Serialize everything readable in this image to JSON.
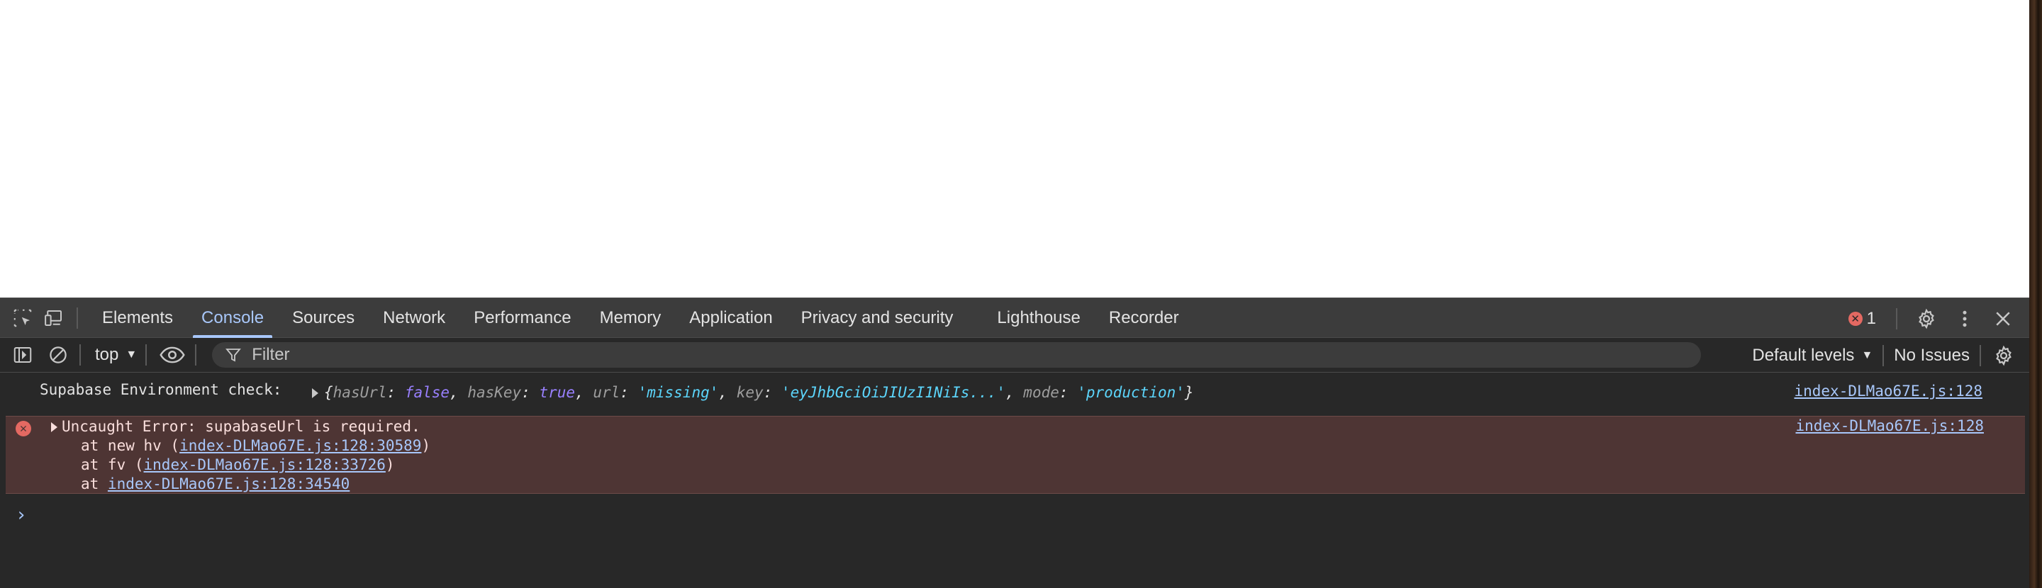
{
  "tabs": [
    "Elements",
    "Console",
    "Sources",
    "Network",
    "Performance",
    "Memory",
    "Application",
    "Privacy and security",
    "Lighthouse",
    "Recorder"
  ],
  "active_tab": "Console",
  "error_count": "1",
  "toolbar": {
    "context": "top",
    "filter_placeholder": "Filter",
    "levels": "Default levels",
    "issues": "No Issues"
  },
  "log_message": {
    "label": "Supabase Environment check:",
    "object": {
      "hasUrl_key": "hasUrl",
      "hasUrl_val": "false",
      "hasKey_key": "hasKey",
      "hasKey_val": "true",
      "url_key": "url",
      "url_val": "'missing'",
      "key_key": "key",
      "key_val": "'eyJhbGciOiJIUzI1NiIs...'",
      "mode_key": "mode",
      "mode_val": "'production'"
    },
    "source": "index-DLMao67E.js:128"
  },
  "error_message": {
    "title": "Uncaught Error: supabaseUrl is required.",
    "stack": [
      {
        "prefix": "at new hv (",
        "link": "index-DLMao67E.js:128:30589",
        "suffix": ")"
      },
      {
        "prefix": "at fv (",
        "link": "index-DLMao67E.js:128:33726",
        "suffix": ")"
      },
      {
        "prefix": "at ",
        "link": "index-DLMao67E.js:128:34540",
        "suffix": ""
      }
    ],
    "source": "index-DLMao67E.js:128"
  },
  "colors": {
    "accent": "#a8c7fa",
    "error": "#e46962",
    "error_bg": "#4e3534",
    "panel_bg": "#282828",
    "tabbar_bg": "#3c3c3c"
  }
}
